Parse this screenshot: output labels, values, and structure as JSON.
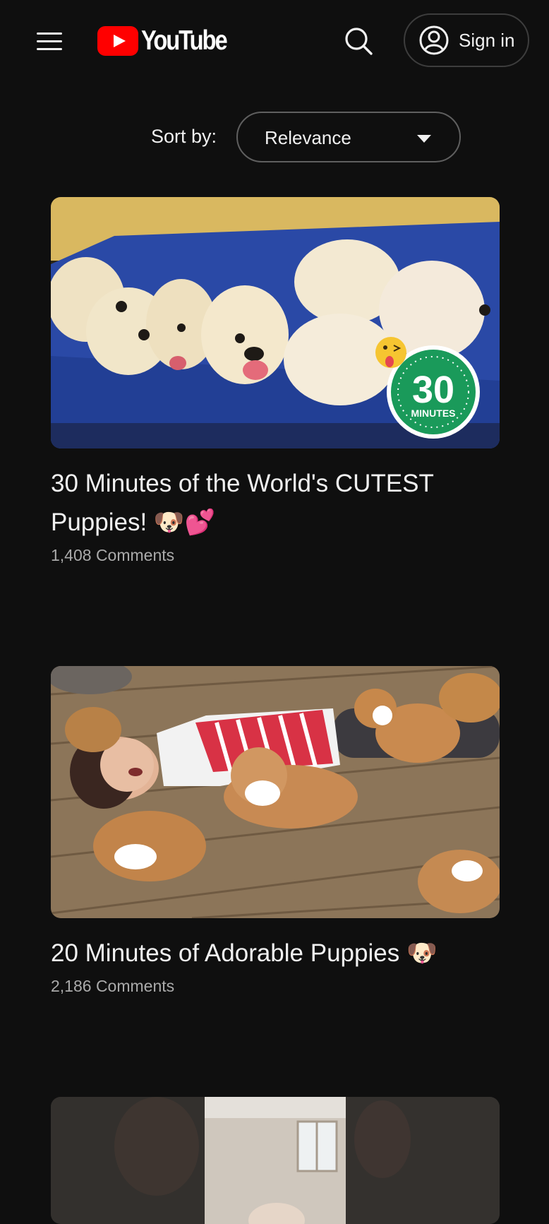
{
  "header": {
    "menu_icon": "hamburger-menu-icon",
    "logo_text": "YouTube",
    "search_icon": "search-icon",
    "signin_label": "Sign in",
    "signin_icon": "account-circle-icon"
  },
  "sort": {
    "label": "Sort by:",
    "value": "Relevance",
    "caret_icon": "dropdown-caret-icon"
  },
  "videos": [
    {
      "title": "30 Minutes of the World's CUTEST Puppies! 🐶💕",
      "comments": "1,408 Comments",
      "badge_number": "30",
      "badge_label": "MINUTES"
    },
    {
      "title": "20 Minutes of Adorable Puppies 🐶",
      "comments": "2,186 Comments"
    },
    {
      "title": "",
      "comments": ""
    }
  ],
  "colors": {
    "background": "#0f0f0f",
    "text_primary": "#f1f1f1",
    "text_secondary": "#aaaaaa",
    "youtube_red": "#ff0000",
    "button_border": "#3d3d3d"
  }
}
